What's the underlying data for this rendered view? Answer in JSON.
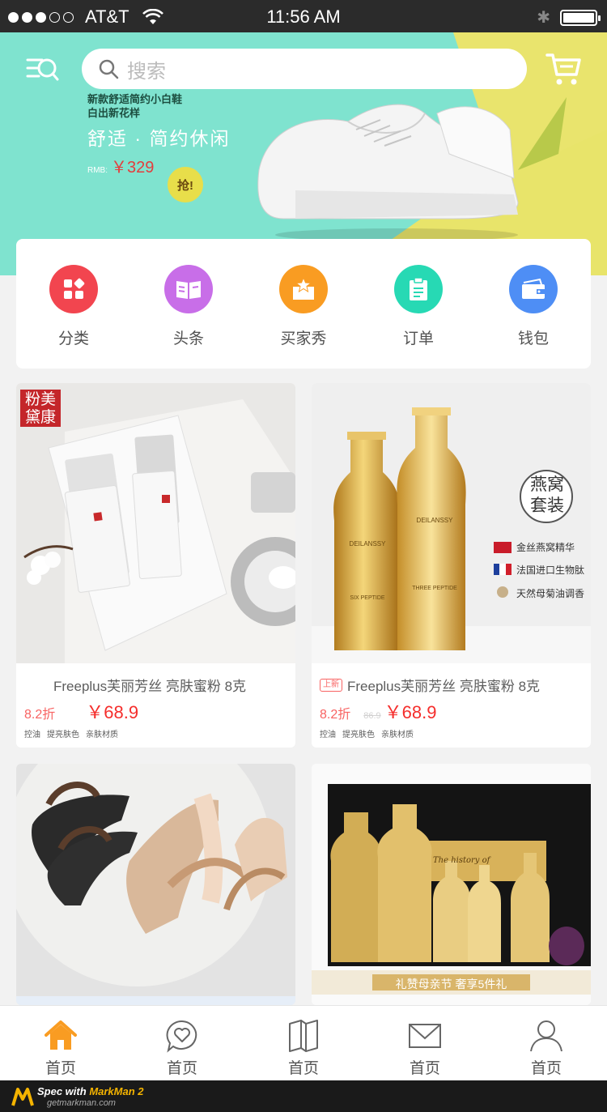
{
  "status_bar": {
    "carrier": "AT&T",
    "time": "11:56 AM",
    "signal_bars_filled": 3,
    "signal_bars_total": 5
  },
  "header": {
    "search_placeholder": "搜索"
  },
  "banner": {
    "line1": "新款舒适简约小白鞋",
    "line2": "白出新花样",
    "slogan": "舒适 · 简约休闲",
    "currency_label": "RMB:",
    "price": "￥329",
    "badge": "抢!"
  },
  "categories": [
    {
      "label": "分类",
      "icon": "grid-icon",
      "color": "#f2454f"
    },
    {
      "label": "头条",
      "icon": "book-icon",
      "color": "#c86ee8"
    },
    {
      "label": "买家秀",
      "icon": "box-star-icon",
      "color": "#f99c22"
    },
    {
      "label": "订单",
      "icon": "clipboard-icon",
      "color": "#27d9b4"
    },
    {
      "label": "钱包",
      "icon": "wallet-icon",
      "color": "#4e8ef5"
    }
  ],
  "products": [
    {
      "tag": "",
      "title": "Freeplus芙丽芳丝 亮肤蜜粉 8克",
      "discount": "8.2折",
      "original_price": "",
      "price": "￥68.9",
      "features": [
        "控油",
        "提亮肤色",
        "亲肤材质"
      ],
      "image_text": "粉美黛康"
    },
    {
      "tag": "上新",
      "title": "Freeplus芙丽芳丝 亮肤蜜粉 8克",
      "discount": "8.2折",
      "original_price": "86.9",
      "price": "￥68.9",
      "features": [
        "控油",
        "提亮肤色",
        "亲肤材质"
      ],
      "image_lines": [
        "燕窝",
        "套装",
        "金丝燕窝精华",
        "法国进口生物肽",
        "天然母菊油调香"
      ],
      "bottle_brand": "DEILANSSY",
      "bottle_left": "SIX PEPTIDE",
      "bottle_right": "THREE PEPTIDE"
    },
    {
      "title": "",
      "image": "sandals"
    },
    {
      "title": "",
      "image": "cosmetics-set",
      "banner_text": "礼赞母亲节 奢享5件礼",
      "box_text": "The history of"
    }
  ],
  "tabbar": [
    {
      "label": "首页",
      "icon": "home-icon",
      "active": true
    },
    {
      "label": "首页",
      "icon": "heart-chat-icon",
      "active": false
    },
    {
      "label": "首页",
      "icon": "book-open-icon",
      "active": false
    },
    {
      "label": "首页",
      "icon": "mail-icon",
      "active": false
    },
    {
      "label": "首页",
      "icon": "user-icon",
      "active": false
    }
  ],
  "footer": {
    "brand_prefix": "Spec with",
    "brand": "MarkMan 2",
    "url": "getmarkman.com"
  },
  "colors": {
    "accent": "#f86362",
    "price": "#f52e2c",
    "text": "#5d5d5d",
    "label": "#515151",
    "muted": "#d2d1d1",
    "tab_active": "#f99c22"
  }
}
